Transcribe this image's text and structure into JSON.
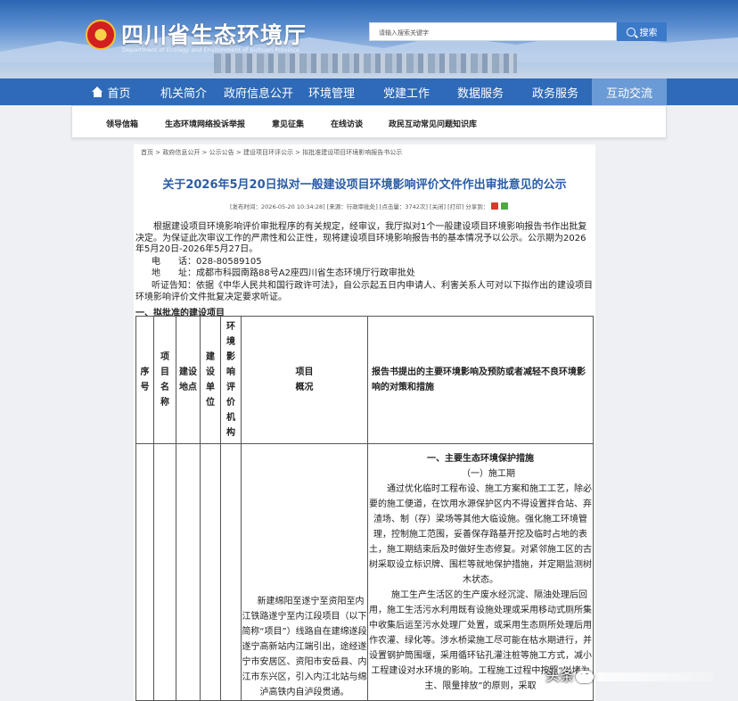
{
  "header": {
    "title": "四川省生态环境厅",
    "subtitle": "Department of Ecology and Environment of Sichuan Province",
    "search_placeholder": "请输入搜索关键字",
    "search_label": "搜索"
  },
  "nav": {
    "items": [
      "首页",
      "机关简介",
      "政府信息公开",
      "环境管理",
      "党建工作",
      "数据服务",
      "政务服务",
      "互动交流"
    ]
  },
  "subnav": {
    "items": [
      "领导信箱",
      "生态环境网络投诉举报",
      "意见征集",
      "在线访谈",
      "政民互动常见问题知识库"
    ]
  },
  "breadcrumb": "首页 > 政府信息公开 > 公示公告 > 建设项目环评公示 > 拟批准建设项目环境影响报告书公示",
  "article": {
    "title": "关于2026年5月20日拟对一般建设项目环境影响评价文件作出审批意见的公示",
    "meta": "[发布时间：2026-05-20 10:34:28] [来源：行政审批处] [点击量：3742次] [关闭] [打印] 分享到：",
    "intro": "根据建设项目环境影响评价审批程序的有关规定，经审议，我厅拟对1个一般建设项目环境影响报告书作出批复决定。为保证此次审议工作的严肃性和公正性，现将建设项目环境影响报告书的基本情况予以公示。公示期为2026年5月20日-2026年5月27日。",
    "phone": "电　　话：028-80589105",
    "address": "地　　址：成都市科园南路88号A2座四川省生态环境厅行政审批处",
    "hearing": "听证告知：依据《中华人民共和国行政许可法》，自公示起五日内申请人、利害关系人可对以下拟作出的建设项目环境影响评价文件批复决定要求听证。",
    "section": "一、拟批准的建设项目"
  },
  "table": {
    "headers": {
      "seq": "序号",
      "name": "项目名称",
      "location": "建设地点",
      "unit": "建设单位",
      "eia": "环境影响评价机构",
      "overview": "项目概况",
      "measures": "报告书提出的主要环境影响及预防或者减轻不良环境影响的对策和措施"
    },
    "row1": {
      "overview": "新建绵阳至遂宁至资阳至内江铁路遂宁至内江段项目（以下简称“项目”）线路自在建绵遂段遂宁高新站内江端引出，途经遂宁市安居区、资阳市安岳县、内江市东兴区，引入内江北站与绵泸高铁内自泸段贯通。",
      "m_heading": "一、主要生态环境保护措施",
      "m_sub": "（一）施工期",
      "m_p1": "通过优化临时工程布设、施工方案和施工工艺，除必要的施工便道，在饮用水源保护区内不得设置拌合站、弃渣场、制（存）梁场等其他大临设施。强化施工环境管理，控制施工范围，妥善保存路基开挖及临时占地的表土，施工期结束后及时做好生态修复。对紧邻施工区的古树采取设立标识牌、围栏等就地保护措施，并定期监测树木状态。",
      "m_p2": "施工生产生活区的生产废水经沉淀、隔油处理后回用，施工生活污水利用既有设施处理或采用移动式厕所集中收集后运至污水处理厂处置，或采用生态厕所处理后用作农灌、绿化等。涉水桥梁施工尽可能在枯水期进行，并设置钢护筒围堰，采用循环钻孔灌注桩等施工方式，减小工程建设对水环境的影响。工程施工过程中按照“以堵为主、限量排放”的原则，采取"
    }
  },
  "watermark": "头条"
}
